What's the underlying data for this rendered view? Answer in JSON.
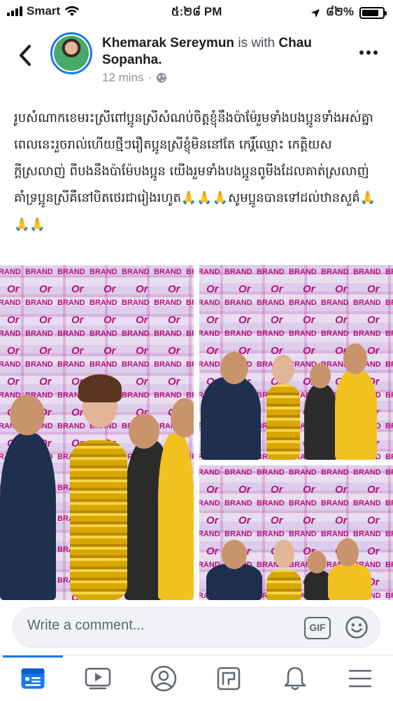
{
  "status_bar": {
    "carrier": "Smart",
    "time": "៥:២៨ PM",
    "battery": "៨២%",
    "battery_level": 0.82
  },
  "post": {
    "author": "Khemarak Sereymun",
    "with_text": "is with",
    "tagged": "Chau Sopanha.",
    "time": "12 mins",
    "privacy_icon": "globe-icon",
    "text": "រូបសំណាកខេមរះស្រីពៅប្អូនស្រីសំណប់ចិត្តខ្ញុំនឹងប៉ាម៉ែរួមទាំងបងប្អូនទាំងអស់គ្នាពេលនេះរួចរាល់ហើយថ្មីៗរឿតប្អូនស្រីខ្ញុំមិននៅតែ កេរ្តិ៍ឈ្មោះ កេត្តិយស ក្តីស្រលាញ់ ពីបងនឹងប៉ាម៉ែបងប្អូន យើងរួមទាំងបងប្អូនពូមីងដែលគាត់ស្រលាញ់គាំទ្រប្អូនស្រីគឺនៅបិតថេរជារៀងរហូត🙏🙏🙏សូមប្អូនបានទៅដល់ឋានសួគ៌🙏🙏🙏"
  },
  "photos": {
    "count": 3,
    "backdrop_text": "BRAND",
    "backdrop_logo": "Or"
  },
  "comment": {
    "placeholder": "Write a comment...",
    "gif_label": "GIF"
  },
  "tabs": [
    {
      "icon": "news-feed-icon",
      "active": true
    },
    {
      "icon": "watch-icon",
      "active": false
    },
    {
      "icon": "profile-icon",
      "active": false
    },
    {
      "icon": "pages-icon",
      "active": false
    },
    {
      "icon": "notifications-icon",
      "active": false
    },
    {
      "icon": "menu-icon",
      "active": false
    }
  ],
  "colors": {
    "accent": "#1877f2",
    "text": "#1c1e21",
    "secondary_text": "#90949c"
  }
}
